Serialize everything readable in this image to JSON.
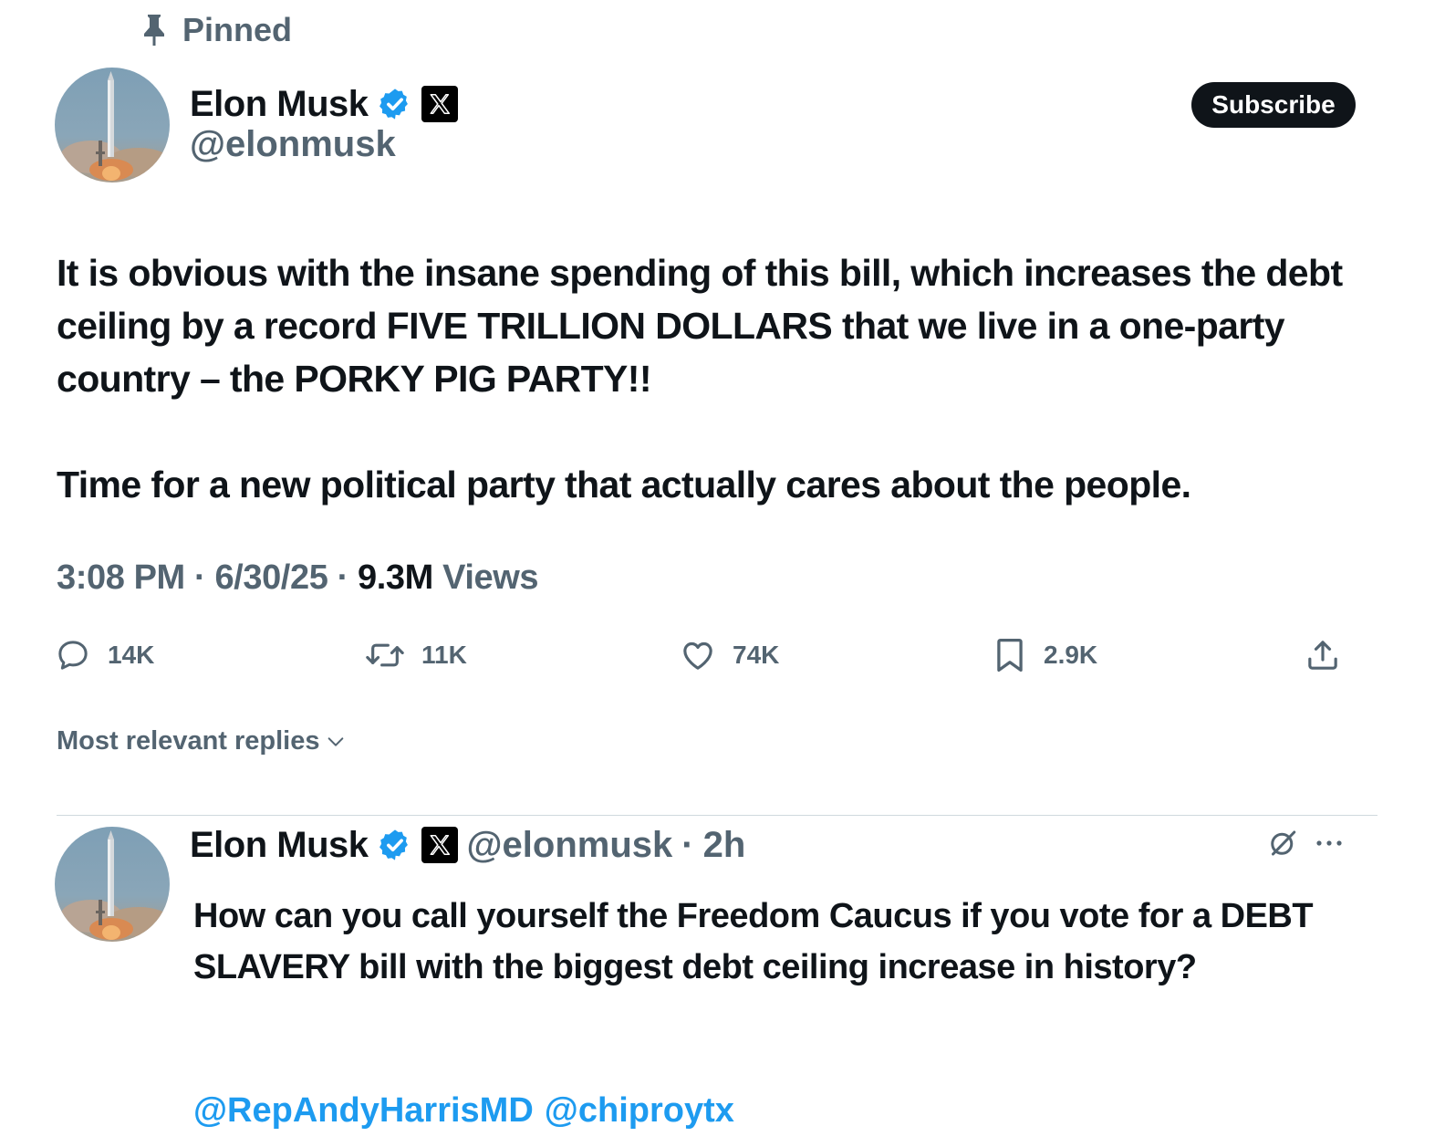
{
  "pinned_label": "Pinned",
  "subscribe_label": "Subscribe",
  "tweet": {
    "author_name": "Elon Musk",
    "author_handle": "@elonmusk",
    "paragraphs": [
      "It is obvious with the insane spending of this bill, which increases the debt ceiling by a record FIVE TRILLION DOLLARS that we live in a one-party country – the PORKY PIG PARTY!!",
      "Time for a new political party that actually cares about the people."
    ],
    "time": "3:08 PM",
    "date": "6/30/25",
    "views_count": "9.3M",
    "views_label": "Views",
    "sep": "·"
  },
  "actions": {
    "replies": "14K",
    "reposts": "11K",
    "likes": "74K",
    "bookmarks": "2.9K"
  },
  "sort_label": "Most relevant replies",
  "reply": {
    "author_name": "Elon Musk",
    "author_handle": "@elonmusk",
    "time": "2h",
    "sep": "·",
    "text": "How can you call yourself the Freedom Caucus if you vote for a DEBT SLAVERY bill with the biggest debt ceiling increase in history?",
    "mentions": [
      "@RepAndyHarrisMD",
      "@chiproytx"
    ]
  },
  "colors": {
    "text": "#0f1419",
    "secondary": "#536471",
    "link": "#1d9bf0",
    "verified": "#1d9bf0",
    "divider": "#cfd9de"
  },
  "icons": [
    "pin-icon",
    "verified-badge-icon",
    "x-logo-icon",
    "reply-icon",
    "repost-icon",
    "like-icon",
    "bookmark-icon",
    "share-icon",
    "chevron-down-icon",
    "grok-icon",
    "more-icon"
  ]
}
